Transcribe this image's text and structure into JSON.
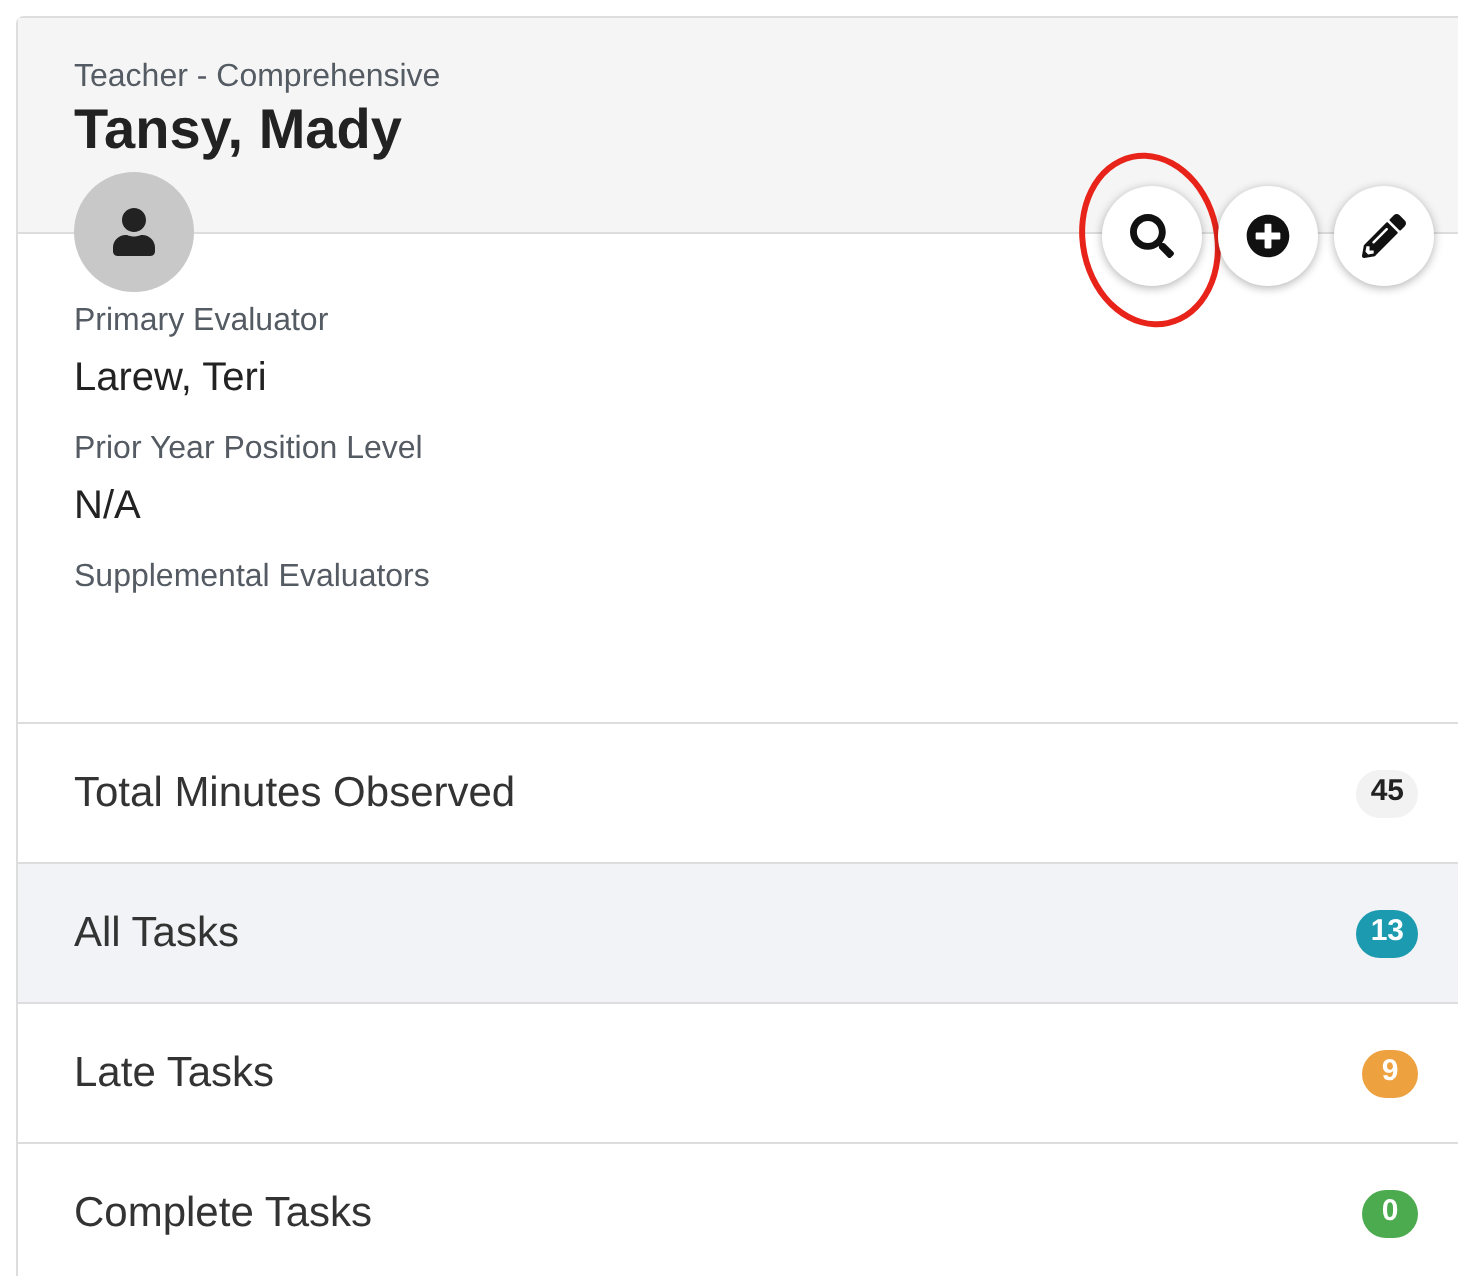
{
  "header": {
    "subtitle": "Teacher - Comprehensive",
    "name": "Tansy, Mady"
  },
  "actions": [
    {
      "kind": "search",
      "highlighted": true
    },
    {
      "kind": "add",
      "highlighted": false
    },
    {
      "kind": "edit",
      "highlighted": false
    }
  ],
  "details": [
    {
      "label": "Primary Evaluator",
      "value": "Larew, Teri"
    },
    {
      "label": "Prior Year Position Level",
      "value": "N/A"
    },
    {
      "label": "Supplemental Evaluators"
    }
  ],
  "stats": [
    {
      "label": "Total Minutes Observed",
      "count": "45",
      "color": "#f2f2f2",
      "selected": false
    },
    {
      "label": "All Tasks",
      "count": "13",
      "color": "#1c9aaf",
      "selected": true
    },
    {
      "label": "Late Tasks",
      "count": "9",
      "color": "#eda13f",
      "selected": false
    },
    {
      "label": "Complete Tasks",
      "count": "0",
      "color": "#4caa4f",
      "selected": false
    }
  ]
}
